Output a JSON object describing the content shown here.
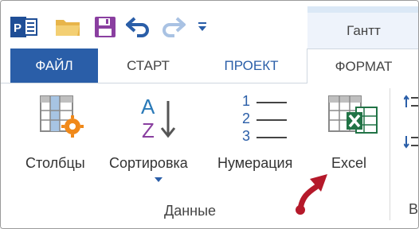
{
  "quick_access": {
    "icons": [
      "project-app-icon",
      "open-folder-icon",
      "save-icon",
      "undo-icon",
      "redo-icon",
      "customize-qat-icon"
    ]
  },
  "tools_tab": {
    "label": "Гантт"
  },
  "tabs": [
    {
      "label": "ФАЙЛ"
    },
    {
      "label": "СТАРТ"
    },
    {
      "label": "ПРОЕКТ"
    },
    {
      "label": "ФОРМАТ"
    }
  ],
  "ribbon": {
    "buttons": [
      {
        "label": "Столбцы",
        "icon": "columns-gear-icon"
      },
      {
        "label": "Сортировка",
        "icon": "sort-az-icon"
      },
      {
        "label": "Нумерация",
        "icon": "numbering-list-icon"
      },
      {
        "label": "Excel",
        "icon": "excel-export-icon"
      }
    ],
    "numbering_digits": [
      "1",
      "2",
      "3"
    ],
    "group_label": "Данные",
    "next_group_initial": "В"
  },
  "colors": {
    "file_tab": "#2a5ea8",
    "project_tab_text": "#2a5ea8",
    "excel_green": "#217346",
    "gear_orange": "#f0891a",
    "arrow_red": "#b5192a",
    "sort_blue": "#2a7ab8",
    "sort_purple": "#8a3fa0"
  }
}
